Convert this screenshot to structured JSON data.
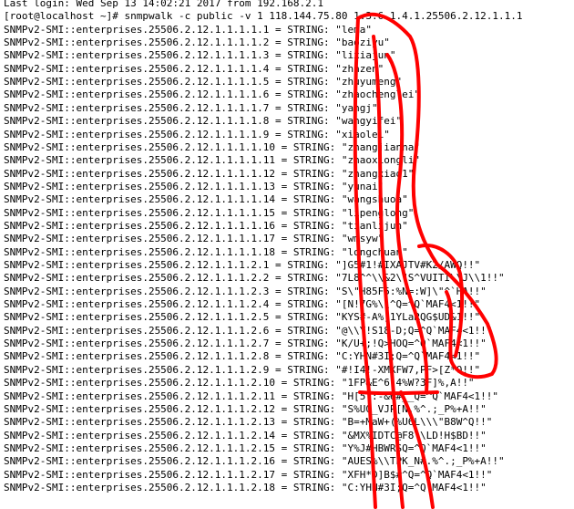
{
  "terminal": {
    "lines": [
      "Last login: Wed Sep 13 14:02:21 2017 from 192.168.2.1",
      "[root@localhost ~]# snmpwalk -c public -v 1 118.144.75.80 1.3.6.1.4.1.25506.2.12.1.1.1",
      "SNMPv2-SMI::enterprises.25506.2.12.1.1.1.1.1 = STRING: \"lema\"",
      "SNMPv2-SMI::enterprises.25506.2.12.1.1.1.1.2 = STRING: \"baoziyu\"",
      "SNMPv2-SMI::enterprises.25506.2.12.1.1.1.1.3 = STRING: \"lixiajun\"",
      "SNMPv2-SMI::enterprises.25506.2.12.1.1.1.1.4 = STRING: \"zhnzen\"",
      "SNMPv2-SMI::enterprises.25506.2.12.1.1.1.1.5 = STRING: \"zhuyumeng\"",
      "SNMPv2-SMI::enterprises.25506.2.12.1.1.1.1.6 = STRING: \"zhaochenglei\"",
      "SNMPv2-SMI::enterprises.25506.2.12.1.1.1.1.7 = STRING: \"yangj\"",
      "SNMPv2-SMI::enterprises.25506.2.12.1.1.1.1.8 = STRING: \"wangyifei\"",
      "SNMPv2-SMI::enterprises.25506.2.12.1.1.1.1.9 = STRING: \"xiaolei\"",
      "SNMPv2-SMI::enterprises.25506.2.12.1.1.1.1.10 = STRING: \"zhangjianna\"",
      "SNMPv2-SMI::enterprises.25506.2.12.1.1.1.1.11 = STRING: \"zhaoxiongli\"",
      "SNMPv2-SMI::enterprises.25506.2.12.1.1.1.1.12 = STRING: \"zhangxiao1\"",
      "SNMPv2-SMI::enterprises.25506.2.12.1.1.1.1.13 = STRING: \"yunai\"",
      "SNMPv2-SMI::enterprises.25506.2.12.1.1.1.1.14 = STRING: \"wangshuoa\"",
      "SNMPv2-SMI::enterprises.25506.2.12.1.1.1.1.15 = STRING: \"lipenglong\"",
      "SNMPv2-SMI::enterprises.25506.2.12.1.1.1.1.16 = STRING: \"tianlijun\"",
      "SNMPv2-SMI::enterprises.25506.2.12.1.1.1.1.17 = STRING: \"wmsyw\"",
      "SNMPv2-SMI::enterprises.25506.2.12.1.1.1.1.18 = STRING: \"longchuan\"",
      "SNMPv2-SMI::enterprises.25506.2.12.1.1.1.2.1 = STRING: \"]G5#1!#IXAJTV#K2/AWQ!!\"",
      "SNMPv2-SMI::enterprises.25506.2.12.1.1.1.2.2 = STRING: \"7L8^^\\\\&2\\\"S^VUITI\\\\J\\\\1!!\"",
      "SNMPv2-SMI::enterprises.25506.2.12.1.1.1.2.3 = STRING: \"S\\\"H85F5:%N=:W]\\\"^`HA!!\"",
      "SNMPv2-SMI::enterprises.25506.2.12.1.1.1.2.4 = STRING: \"[N!7G%\\\\^Q=^Q`MAF4<1!!\"",
      "SNMPv2-SMI::enterprises.25506.2.12.1.1.1.2.5 = STRING: \"KYS#-A%]1YLaRQG$UD&1!!\"",
      "SNMPv2-SMI::enterprises.25506.2.12.1.1.1.2.6 = STRING: \"@\\\\Y!S18-D;Q=^Q`MAF4<1!!\"",
      "SNMPv2-SMI::enterprises.25506.2.12.1.1.1.2.7 = STRING: \"K/U+;!Q>HOQ=^Q`MAF4<1!!\"",
      "SNMPv2-SMI::enterprises.25506.2.12.1.1.1.2.8 = STRING: \"C:YHN#3I;Q=^Q`MAF4<1!!\"",
      "SNMPv2-SMI::enterprises.25506.2.12.1.1.1.2.9 = STRING: \"#!I4!-XMXFW7,PF>[Z*Q!!\"",
      "SNMPv2-SMI::enterprises.25506.2.12.1.1.1.2.10 = STRING: \"1FP&E^6!4%W?3F]%,A!!\"",
      "SNMPv2-SMI::enterprises.25506.2.12.1.1.1.2.11 = STRING: \"H[5!:-&6#__Q=^Q`MAF4<1!!\"",
      "SNMPv2-SMI::enterprises.25506.2.12.1.1.1.2.12 = STRING: \"S%U0_VJP[N.%^.;_P%+A!!\"",
      "SNMPv2-SMI::enterprises.25506.2.12.1.1.1.2.13 = STRING: \"B=+MaW+(%U6L\\\\\\\"B8W^Q!!\"",
      "SNMPv2-SMI::enterprises.25506.2.12.1.1.1.2.14 = STRING: \"&MX%IDTC@F8\\\\LD!H$BD!!\"",
      "SNMPv2-SMI::enterprises.25506.2.12.1.1.1.2.15 = STRING: \"Y%J#HBWRSQ=^Q`MAF4<1!!\"",
      "SNMPv2-SMI::enterprises.25506.2.12.1.1.1.2.16 = STRING: \"AUES%\\\\TPK_N#.%^.;_P%+A!!\"",
      "SNMPv2-SMI::enterprises.25506.2.12.1.1.1.2.17 = STRING: \"XFH*D]B$#^Q=^Q`MAF4<1!!\"",
      "SNMPv2-SMI::enterprises.25506.2.12.1.1.1.2.18 = STRING: \"C:YHN#3I;Q=^Q`MAF4<1!!\""
    ]
  },
  "annotation": {
    "color": "#ff0000"
  }
}
